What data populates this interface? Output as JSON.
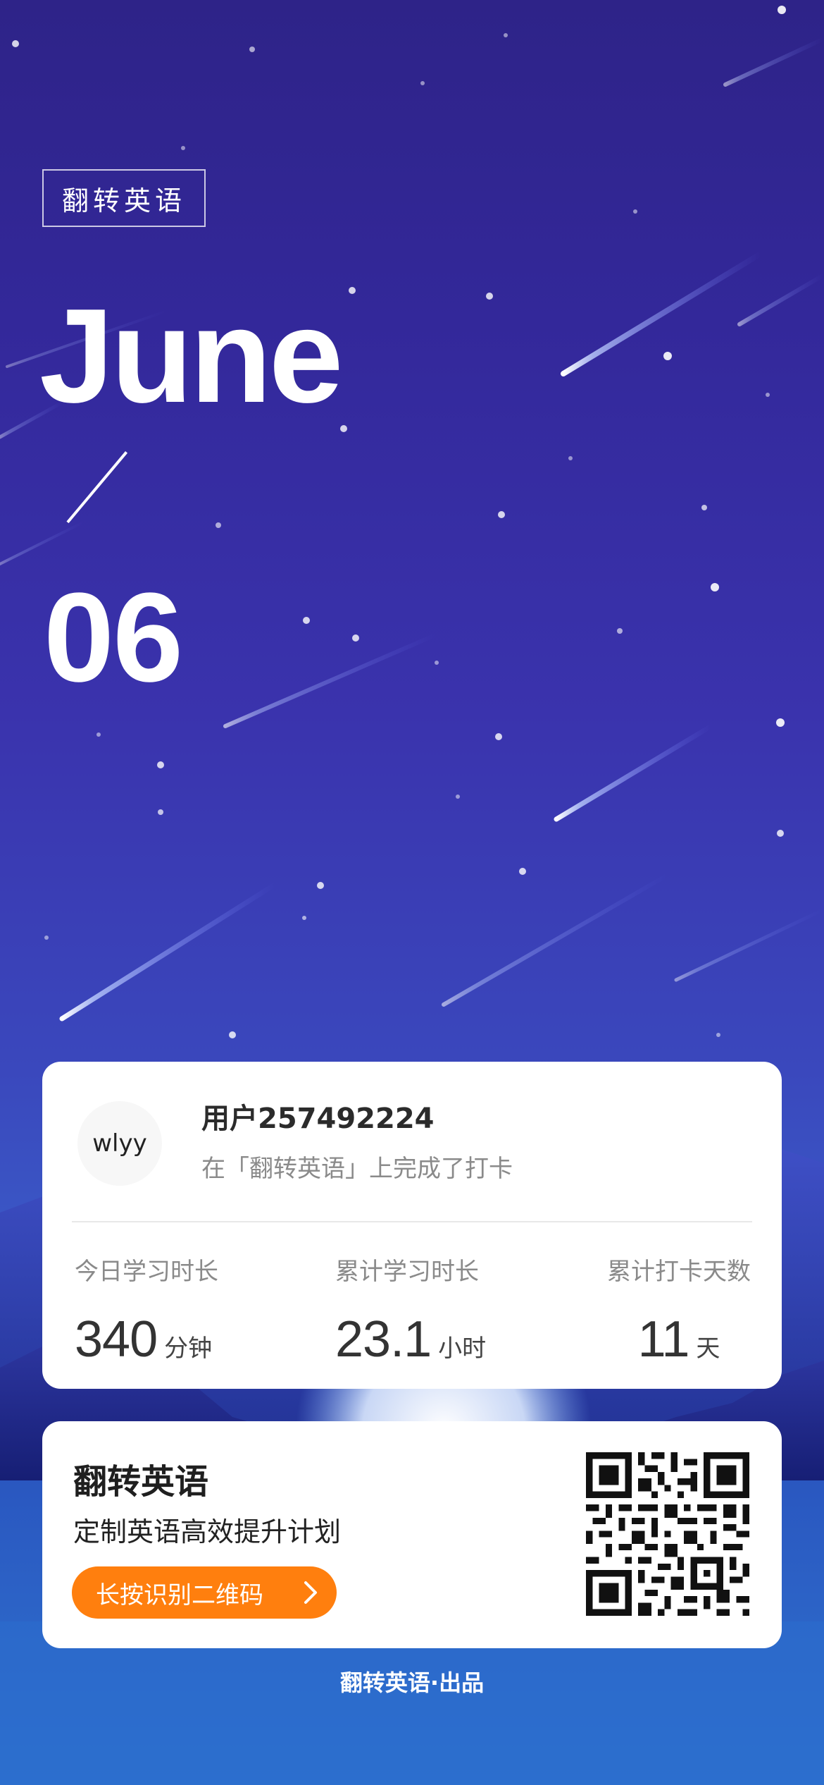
{
  "brand_tag": "翻转英语",
  "date": {
    "month": "June",
    "day": "06"
  },
  "user": {
    "avatar_text": "wlyy",
    "name": "用户257492224",
    "subtitle": "在「翻转英语」上完成了打卡"
  },
  "stats": [
    {
      "label": "今日学习时长",
      "value": "340",
      "unit": "分钟"
    },
    {
      "label": "累计学习时长",
      "value": "23.1",
      "unit": "小时"
    },
    {
      "label": "累计打卡天数",
      "value": "11",
      "unit": "天"
    }
  ],
  "promo": {
    "title": "翻转英语",
    "subtitle": "定制英语高效提升计划",
    "button_label": "长按识别二维码",
    "button_icon": "chevron-right-icon",
    "qr_icon": "qr-code"
  },
  "footer": "翻转英语·出品",
  "colors": {
    "background_top": "#2e2388",
    "background_bottom": "#2a6cc9",
    "accent": "#ff7f0e",
    "card": "#ffffff"
  }
}
